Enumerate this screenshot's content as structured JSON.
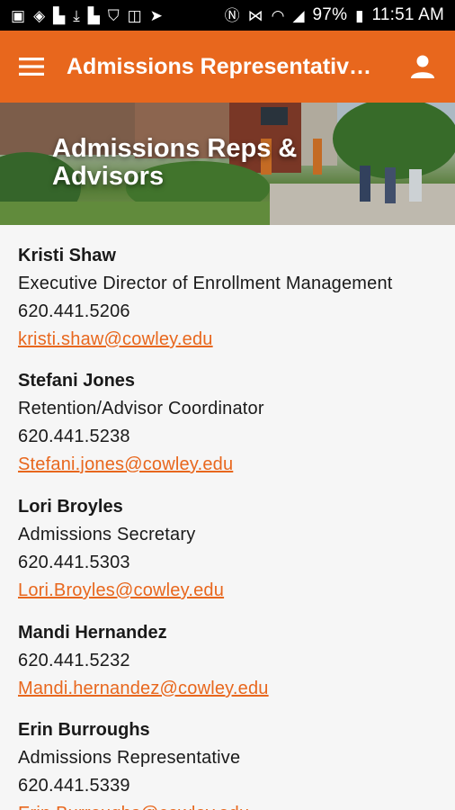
{
  "status_bar": {
    "battery": "97%",
    "time": "11:51 AM",
    "left_icons": [
      "gallery-icon",
      "wifi-shield-icon",
      "flipboard-icon",
      "download-icon",
      "flipboard-icon",
      "shield-icon",
      "translate-icon",
      "send-icon"
    ],
    "right_icons": [
      "nfc-icon",
      "vibrate-icon",
      "wifi-icon",
      "signal-icon",
      "battery-icon"
    ]
  },
  "app_bar": {
    "title": "Admissions Representativ…",
    "menu_icon": "menu-icon",
    "account_icon": "account-icon",
    "color": "#e8671d"
  },
  "hero": {
    "title": "Admissions Reps & Advisors"
  },
  "contacts": [
    {
      "name": "Kristi Shaw",
      "title": "Executive Director of Enrollment Management",
      "phone": "620.441.5206",
      "email": "kristi.shaw@cowley.edu"
    },
    {
      "name": "Stefani Jones",
      "title": "Retention/Advisor Coordinator",
      "phone": "620.441.5238",
      "email": "Stefani.jones@cowley.edu"
    },
    {
      "name": "Lori Broyles",
      "title": "Admissions Secretary",
      "phone": "620.441.5303",
      "email": "Lori.Broyles@cowley.edu"
    },
    {
      "name": "Mandi Hernandez",
      "phone": "620.441.5232",
      "email": "Mandi.hernandez@cowley.edu"
    },
    {
      "name": "Erin Burroughs",
      "title": "Admissions Representative",
      "phone": "620.441.5339",
      "email": "Erin.Burroughs@cowley.edu"
    }
  ]
}
